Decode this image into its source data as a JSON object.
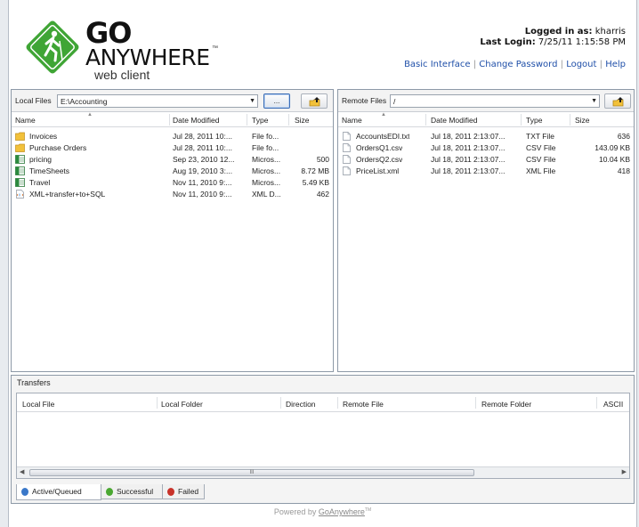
{
  "header": {
    "logo": {
      "go": "GO",
      "anywhere": "ANYWHERE",
      "tm": "™",
      "web_client": "web client"
    },
    "logged_in_label": "Logged in as:",
    "logged_in_user": "kharris",
    "last_login_label": "Last Login:",
    "last_login_value": "7/25/11 1:15:58 PM",
    "links": [
      "Basic Interface",
      "Change Password",
      "Logout",
      "Help"
    ],
    "link_separator": "|"
  },
  "local": {
    "label": "Local Files",
    "path": "E:\\Accounting",
    "browse_label": "...",
    "columns": [
      "Name",
      "Date Modified",
      "Type",
      "Size"
    ],
    "files": [
      {
        "name": "Invoices",
        "date": "Jul 28, 2011 10:...",
        "type": "File fo...",
        "size": "",
        "icon": "folder-icon"
      },
      {
        "name": "Purchase Orders",
        "date": "Jul 28, 2011 10:...",
        "type": "File fo...",
        "size": "",
        "icon": "folder-icon"
      },
      {
        "name": "pricing",
        "date": "Sep 23, 2010 12...",
        "type": "Micros...",
        "size": "500",
        "icon": "spreadsheet-icon"
      },
      {
        "name": "TimeSheets",
        "date": "Aug 19, 2010 3:...",
        "type": "Micros...",
        "size": "8.72 MB",
        "icon": "spreadsheet-icon"
      },
      {
        "name": "Travel",
        "date": "Nov 11, 2010 9:...",
        "type": "Micros...",
        "size": "5.49 KB",
        "icon": "spreadsheet-icon"
      },
      {
        "name": "XML+transfer+to+SQL",
        "date": "Nov 11, 2010 9:...",
        "type": "XML D...",
        "size": "462",
        "icon": "xml-file-icon"
      }
    ]
  },
  "remote": {
    "label": "Remote Files",
    "path": "/",
    "columns": [
      "Name",
      "Date Modified",
      "Type",
      "Size"
    ],
    "files": [
      {
        "name": "AccountsEDI.txt",
        "date": "Jul 18, 2011 2:13:07...",
        "type": "TXT File",
        "size": "636",
        "icon": "document-icon"
      },
      {
        "name": "OrdersQ1.csv",
        "date": "Jul 18, 2011 2:13:07...",
        "type": "CSV File",
        "size": "143.09 KB",
        "icon": "document-icon"
      },
      {
        "name": "OrdersQ2.csv",
        "date": "Jul 18, 2011 2:13:07...",
        "type": "CSV File",
        "size": "10.04 KB",
        "icon": "document-icon"
      },
      {
        "name": "PriceList.xml",
        "date": "Jul 18, 2011 2:13:07...",
        "type": "XML File",
        "size": "418",
        "icon": "document-icon"
      }
    ]
  },
  "transfers": {
    "title": "Transfers",
    "columns": [
      "Local File",
      "Local Folder",
      "Direction",
      "Remote File",
      "Remote Folder",
      "ASCII"
    ],
    "scroll_grip": "III",
    "tabs": [
      {
        "label": "Active/Queued",
        "color": "#3a78c9"
      },
      {
        "label": "Successful",
        "color": "#4aa832"
      },
      {
        "label": "Failed",
        "color": "#c8322a"
      }
    ]
  },
  "footer": {
    "powered_by": "Powered by",
    "brand": "GoAnywhere",
    "tm": "TM"
  },
  "colors": {
    "accent": "#3fa535",
    "link": "#1f4fa8",
    "border": "#8d99a7"
  }
}
